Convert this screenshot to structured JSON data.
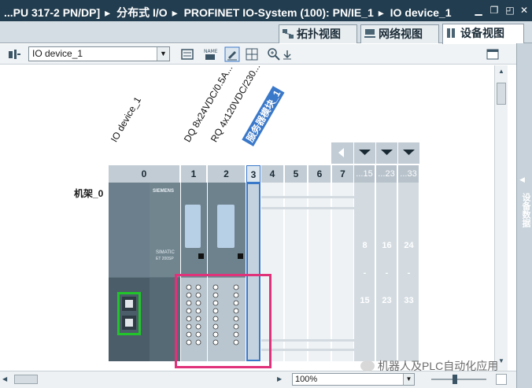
{
  "titlebar": {
    "crumbs": [
      "...PU 317-2 PN/DP]",
      "分布式 I/O",
      "PROFINET IO-System (100): PN/IE_1",
      "IO device_1"
    ]
  },
  "view_tabs": [
    {
      "label": "拓扑视图",
      "icon": "topology-icon"
    },
    {
      "label": "网络视图",
      "icon": "network-icon"
    },
    {
      "label": "设备视图",
      "icon": "device-icon",
      "active": true
    }
  ],
  "toolbar": {
    "device_select": "IO device_1"
  },
  "canvas": {
    "device_label": "IO device_1",
    "module_labels": [
      "DQ 8x24VDC/0.5A...",
      "RQ 4x120VDC/230...",
      "服务器模块_1"
    ],
    "rack_label": "机架_0",
    "slot_numbers": [
      "0",
      "1",
      "2",
      "3",
      "4",
      "5",
      "6",
      "7"
    ],
    "extra_slot_headers": [
      "...15",
      "...23",
      "...33"
    ],
    "extra_slot_top": [
      "8",
      "16",
      "24"
    ],
    "extra_slot_dash": [
      "-",
      "-",
      "-"
    ],
    "extra_slot_bottom": [
      "15",
      "23",
      "33"
    ],
    "module_brand": "SIEMENS",
    "module_name": "SIMATIC",
    "module_sub": "ET 200SP"
  },
  "side_panel": {
    "label": "设备数据"
  },
  "bottom": {
    "zoom": "100%"
  },
  "watermark": "机器人及PLC自动化应用",
  "colors": {
    "titlebar": "#223d4f",
    "selection": "#3a78c9",
    "highlight_box": "#e0327a",
    "module_body": "#5f7380"
  }
}
